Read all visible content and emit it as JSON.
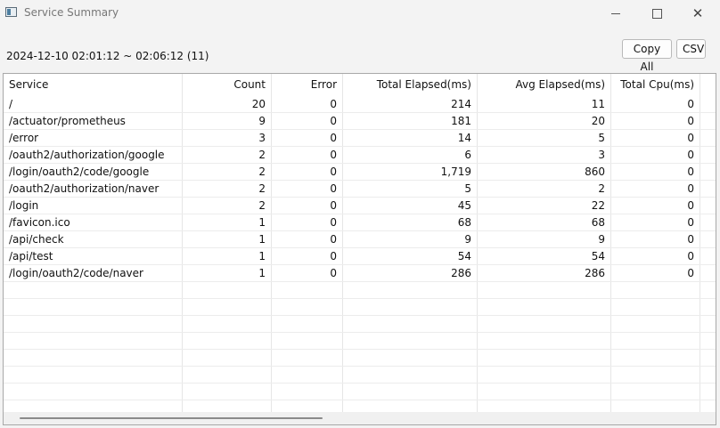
{
  "window": {
    "title": "Service Summary",
    "controls": {
      "minimize_icon": "minimize-icon",
      "maximize_icon": "maximize-icon",
      "close_icon": "close-icon"
    }
  },
  "toolbar": {
    "range_label": "2024-12-10 02:01:12 ~ 02:06:12 (11)",
    "copy_all_label": "Copy All",
    "csv_label": "CSV"
  },
  "table": {
    "columns": [
      "Service",
      "Count",
      "Error",
      "Total Elapsed(ms)",
      "Avg Elapsed(ms)",
      "Total Cpu(ms)"
    ],
    "rows": [
      [
        "/",
        "20",
        "0",
        "214",
        "11",
        "0"
      ],
      [
        "/actuator/prometheus",
        "9",
        "0",
        "181",
        "20",
        "0"
      ],
      [
        "/error",
        "3",
        "0",
        "14",
        "5",
        "0"
      ],
      [
        "/oauth2/authorization/google",
        "2",
        "0",
        "6",
        "3",
        "0"
      ],
      [
        "/login/oauth2/code/google",
        "2",
        "0",
        "1,719",
        "860",
        "0"
      ],
      [
        "/oauth2/authorization/naver",
        "2",
        "0",
        "5",
        "2",
        "0"
      ],
      [
        "/login",
        "2",
        "0",
        "45",
        "22",
        "0"
      ],
      [
        "/favicon.ico",
        "1",
        "0",
        "68",
        "68",
        "0"
      ],
      [
        "/api/check",
        "1",
        "0",
        "9",
        "9",
        "0"
      ],
      [
        "/api/test",
        "1",
        "0",
        "54",
        "54",
        "0"
      ],
      [
        "/login/oauth2/code/naver",
        "1",
        "0",
        "286",
        "286",
        "0"
      ]
    ]
  }
}
